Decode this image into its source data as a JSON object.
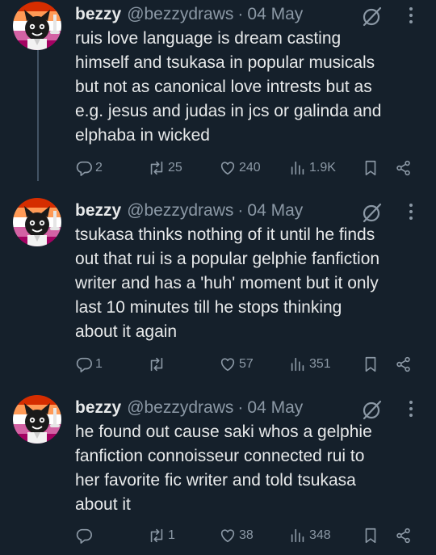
{
  "colors": {
    "background": "#15202b",
    "text": "#e7e9ea",
    "muted": "#8b98a5",
    "thread_line": "#425364"
  },
  "tweets": [
    {
      "name": "bezzy",
      "handle": "@bezzydraws",
      "separator": "·",
      "date": "04 May",
      "text": "ruis love language is dream casting\nhimself and tsukasa in popular musicals\nbut not as canonical love intrests but as\ne.g. jesus and judas in jcs or galinda and\nelphaba in wicked",
      "replies": "2",
      "retweets": "25",
      "likes": "240",
      "views": "1.9K"
    },
    {
      "name": "bezzy",
      "handle": "@bezzydraws",
      "separator": "·",
      "date": "04 May",
      "text": "tsukasa thinks nothing of it until he finds\nout that rui is a popular gelphie fanfiction\nwriter and has a 'huh' moment but it only\nlast 10 minutes till he stops thinking\nabout it again",
      "replies": "1",
      "retweets": "",
      "likes": "57",
      "views": "351"
    },
    {
      "name": "bezzy",
      "handle": "@bezzydraws",
      "separator": "·",
      "date": "04 May",
      "text": "he found out cause saki whos a gelphie\nfanfiction connoisseur connected rui to\nher favorite fic writer and told tsukasa\nabout it",
      "replies": "",
      "retweets": "1",
      "likes": "38",
      "views": "348"
    }
  ],
  "icons": {
    "reply": "reply-icon",
    "retweet": "retweet-icon",
    "like": "heart-icon",
    "views": "views-icon",
    "bookmark": "bookmark-icon",
    "share": "share-icon",
    "grok": "grok-icon",
    "more": "more-icon"
  }
}
